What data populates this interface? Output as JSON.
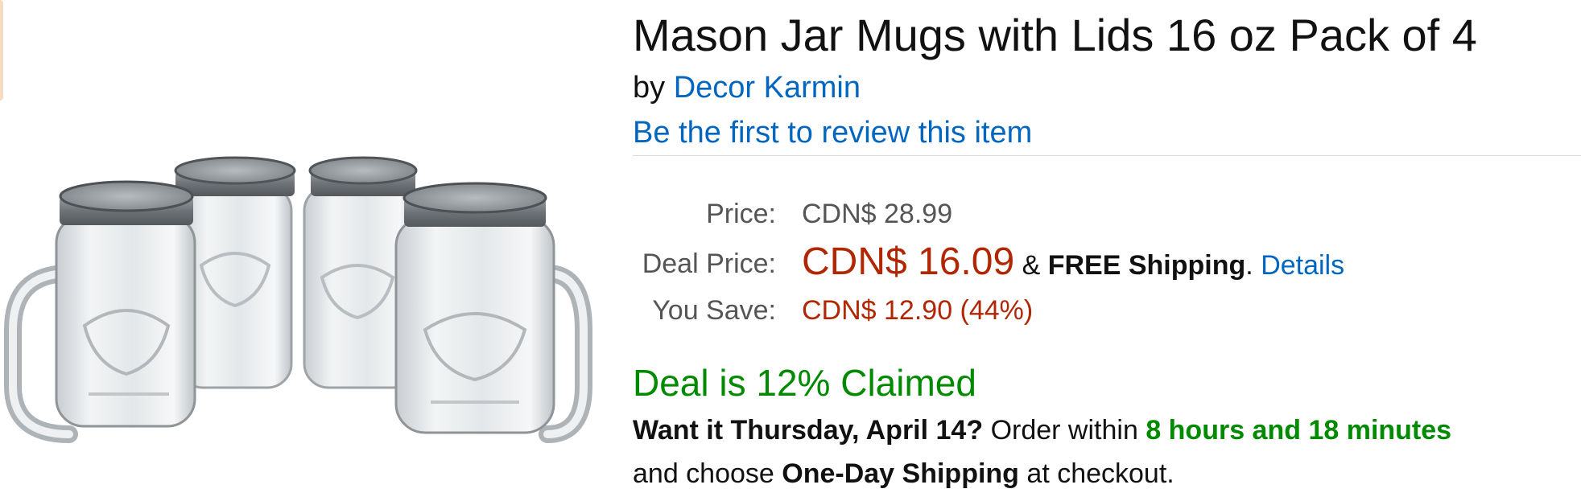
{
  "product": {
    "title": "Mason Jar Mugs with Lids 16 oz Pack of 4",
    "by_prefix": "by",
    "brand": "Decor Karmin",
    "review_link": "Be the first to review this item",
    "image_icon": "mason-jar-mugs-product-image"
  },
  "pricing": {
    "list_label": "Price:",
    "list_value": "CDN$ 28.99",
    "deal_label": "Deal Price:",
    "deal_value": "CDN$ 16.09",
    "shipping_joiner": "&",
    "shipping_text": "FREE Shipping",
    "period": ".",
    "details_link": "Details",
    "save_label": "You Save:",
    "save_value": "CDN$ 12.90 (44%)"
  },
  "deal": {
    "claimed_text": "Deal is 12% Claimed",
    "claimed_percent": 12
  },
  "delivery": {
    "want_it": "Want it Thursday, April 14?",
    "order_within": "Order within",
    "countdown": "8 hours and 18 minutes",
    "and_choose": "and choose",
    "shipping_option": "One-Day Shipping",
    "at_checkout": "at checkout."
  },
  "colors": {
    "link": "#0066c0",
    "price_red": "#b12704",
    "deal_green": "#008a00"
  }
}
